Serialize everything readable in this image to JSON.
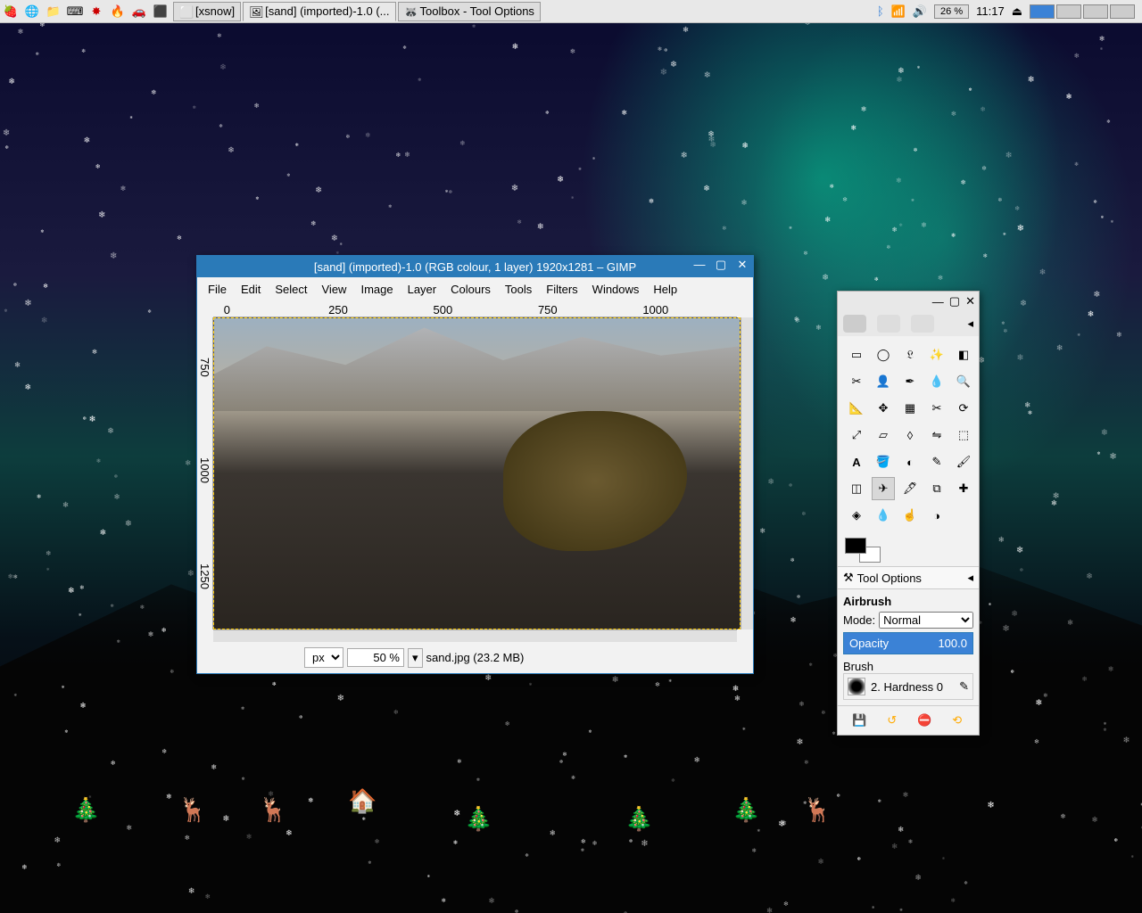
{
  "taskbar": {
    "tasks": [
      {
        "label": "[xsnow]"
      },
      {
        "label": "[sand] (imported)-1.0 (..."
      },
      {
        "label": "Toolbox - Tool Options"
      }
    ],
    "battery": "26 %",
    "clock": "11:17"
  },
  "gimp": {
    "title": "[sand] (imported)-1.0 (RGB colour, 1 layer) 1920x1281 – GIMP",
    "menu": [
      "File",
      "Edit",
      "Select",
      "View",
      "Image",
      "Layer",
      "Colours",
      "Tools",
      "Filters",
      "Windows",
      "Help"
    ],
    "ruler_h": [
      "0",
      "250",
      "500",
      "750",
      "1000"
    ],
    "ruler_v": [
      "750",
      "1000",
      "1250"
    ],
    "unit": "px",
    "zoom": "50 %",
    "status": "sand.jpg (23.2 MB)"
  },
  "toolbox": {
    "tool_options_label": "Tool Options",
    "tool_name": "Airbrush",
    "mode_label": "Mode:",
    "mode_value": "Normal",
    "opacity_label": "Opacity",
    "opacity_value": "100.0",
    "brush_label": "Brush",
    "brush_value": "2. Hardness 0",
    "tools": [
      "rect-select",
      "ellipse-select",
      "free-select",
      "fuzzy-select",
      "by-color-select",
      "scissors",
      "foreground-select",
      "paths",
      "color-picker",
      "zoom",
      "measure",
      "move",
      "align",
      "crop",
      "rotate",
      "scale",
      "shear",
      "perspective",
      "flip",
      "cage",
      "text",
      "bucket-fill",
      "blend",
      "pencil",
      "paintbrush",
      "eraser",
      "airbrush",
      "ink",
      "clone",
      "heal",
      "perspective-clone",
      "blur",
      "smudge",
      "dodge"
    ],
    "selected_tool": "airbrush"
  }
}
